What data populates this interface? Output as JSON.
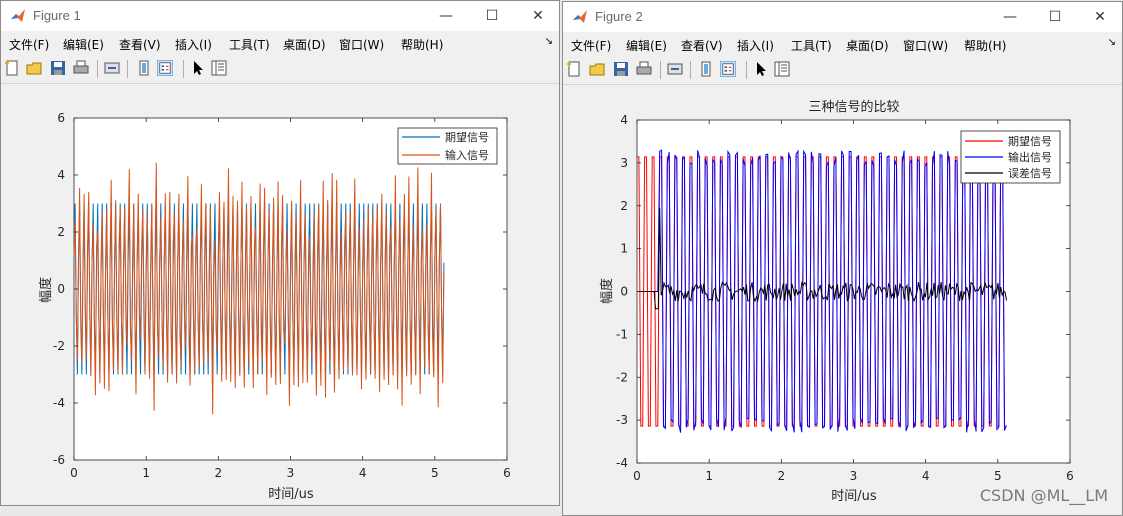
{
  "window1": {
    "title": "Figure 1",
    "menu": [
      "文件(F)",
      "编辑(E)",
      "查看(V)",
      "插入(I)",
      "工具(T)",
      "桌面(D)",
      "窗口(W)",
      "帮助(H)"
    ],
    "controls": {
      "minimize": "—",
      "maximize": "☐",
      "close": "✕"
    }
  },
  "window2": {
    "title": "Figure 2",
    "menu": [
      "文件(F)",
      "编辑(E)",
      "查看(V)",
      "插入(I)",
      "工具(T)",
      "桌面(D)",
      "窗口(W)",
      "帮助(H)"
    ],
    "controls": {
      "minimize": "—",
      "maximize": "☐",
      "close": "✕"
    }
  },
  "watermark": "CSDN @ML__LM",
  "chart_data": [
    {
      "type": "line",
      "title": "",
      "xlabel": "时间/us",
      "ylabel": "幅度",
      "xlim": [
        0,
        6
      ],
      "ylim": [
        -6,
        6
      ],
      "xticks": [
        0,
        1,
        2,
        3,
        4,
        5,
        6
      ],
      "yticks": [
        -6,
        -4,
        -2,
        0,
        2,
        4,
        6
      ],
      "legend_position": "top-right",
      "series": [
        {
          "name": "期望信号",
          "color": "#0072bd",
          "amplitude": 3.14,
          "x_end": 5.12
        },
        {
          "name": "输入信号",
          "color": "#d95319",
          "amplitude_range": [
            -5.6,
            5.7
          ],
          "x_end": 5.12
        }
      ]
    },
    {
      "type": "line",
      "title": "三种信号的比较",
      "xlabel": "时间/us",
      "ylabel": "幅度",
      "xlim": [
        0,
        6
      ],
      "ylim": [
        -4,
        4
      ],
      "xticks": [
        0,
        1,
        2,
        3,
        4,
        5,
        6
      ],
      "yticks": [
        -4,
        -3,
        -2,
        -1,
        0,
        1,
        2,
        3,
        4
      ],
      "legend_position": "top-right",
      "series": [
        {
          "name": "期望信号",
          "color": "#ff0000",
          "amplitude": 3.14,
          "x_end": 5.12
        },
        {
          "name": "输出信号",
          "color": "#0000ff",
          "amplitude_range": [
            -3.4,
            3.55
          ],
          "x_end": 5.12
        },
        {
          "name": "误差信号",
          "color": "#000000",
          "amplitude_range": [
            -0.5,
            2.0
          ],
          "x_end": 5.12
        }
      ]
    }
  ]
}
